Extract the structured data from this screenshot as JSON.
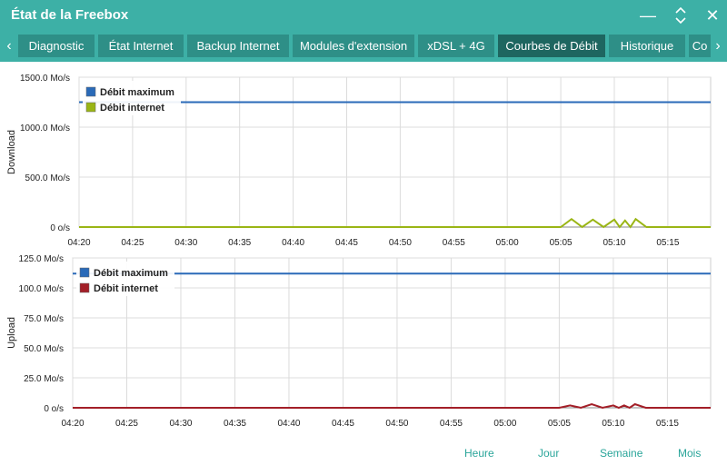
{
  "window": {
    "title": "État de la Freebox",
    "minimize_glyph": "—",
    "menu_glyph": "⌃⌄",
    "close_glyph": "✕"
  },
  "tabs": [
    {
      "label": "Diagnostic",
      "active": false
    },
    {
      "label": "État Internet",
      "active": false
    },
    {
      "label": "Backup Internet",
      "active": false
    },
    {
      "label": "Modules d'extension",
      "active": false
    },
    {
      "label": "xDSL + 4G",
      "active": false
    },
    {
      "label": "Courbes de Débit",
      "active": true
    },
    {
      "label": "Historique",
      "active": false
    },
    {
      "label": "Co",
      "active": false
    }
  ],
  "tab_arrows": {
    "left": "‹",
    "right": "›"
  },
  "colors": {
    "accent": "#3db0a6",
    "tab_bg": "#2e8f87",
    "tab_active": "#1e6660",
    "max_line": "#2a6ab8",
    "download_line": "#9ab515",
    "upload_line": "#a31f28"
  },
  "periods": [
    "Heure",
    "Jour",
    "Semaine",
    "Mois"
  ],
  "chart_data": [
    {
      "type": "line",
      "ylabel": "Download",
      "y_ticks": [
        "1500.0 Mo/s",
        "1000.0 Mo/s",
        "500.0 Mo/s",
        "0 o/s"
      ],
      "y_tick_values": [
        1500,
        1000,
        500,
        0
      ],
      "ylim": [
        0,
        1500
      ],
      "x_ticks": [
        "04:20",
        "04:25",
        "04:30",
        "04:35",
        "04:40",
        "04:45",
        "04:50",
        "04:55",
        "05:00",
        "05:05",
        "05:10",
        "05:15"
      ],
      "x_range": [
        "04:20",
        "05:19"
      ],
      "grid": true,
      "legend_position": "top-left",
      "series": [
        {
          "name": "Débit maximum",
          "color": "#2a6ab8",
          "points": [
            [
              "04:20",
              1250
            ],
            [
              "05:19",
              1250
            ]
          ]
        },
        {
          "name": "Débit internet",
          "color": "#9ab515",
          "points": [
            [
              "04:20",
              0
            ],
            [
              "05:05",
              0
            ],
            [
              "05:06",
              80
            ],
            [
              "05:07",
              0
            ],
            [
              "05:08",
              75
            ],
            [
              "05:09",
              0
            ],
            [
              "05:10",
              75
            ],
            [
              "05:10:30",
              0
            ],
            [
              "05:11",
              65
            ],
            [
              "05:11:30",
              0
            ],
            [
              "05:12",
              80
            ],
            [
              "05:13",
              0
            ],
            [
              "05:19",
              0
            ]
          ]
        }
      ]
    },
    {
      "type": "line",
      "ylabel": "Upload",
      "y_ticks": [
        "125.0 Mo/s",
        "100.0 Mo/s",
        "75.0 Mo/s",
        "50.0 Mo/s",
        "25.0 Mo/s",
        "0 o/s"
      ],
      "y_tick_values": [
        125,
        100,
        75,
        50,
        25,
        0
      ],
      "ylim": [
        0,
        125
      ],
      "x_ticks": [
        "04:20",
        "04:25",
        "04:30",
        "04:35",
        "04:40",
        "04:45",
        "04:50",
        "04:55",
        "05:00",
        "05:05",
        "05:10",
        "05:15"
      ],
      "x_range": [
        "04:20",
        "05:19"
      ],
      "grid": true,
      "legend_position": "top-left",
      "series": [
        {
          "name": "Débit maximum",
          "color": "#2a6ab8",
          "points": [
            [
              "04:20",
              112
            ],
            [
              "05:19",
              112
            ]
          ]
        },
        {
          "name": "Débit internet",
          "color": "#a31f28",
          "points": [
            [
              "04:20",
              0
            ],
            [
              "05:05",
              0
            ],
            [
              "05:06",
              2
            ],
            [
              "05:07",
              0
            ],
            [
              "05:08",
              3
            ],
            [
              "05:09",
              0
            ],
            [
              "05:10",
              2
            ],
            [
              "05:10:30",
              0
            ],
            [
              "05:11",
              2
            ],
            [
              "05:11:30",
              0
            ],
            [
              "05:12",
              3
            ],
            [
              "05:13",
              0
            ],
            [
              "05:19",
              0
            ]
          ]
        }
      ]
    }
  ]
}
